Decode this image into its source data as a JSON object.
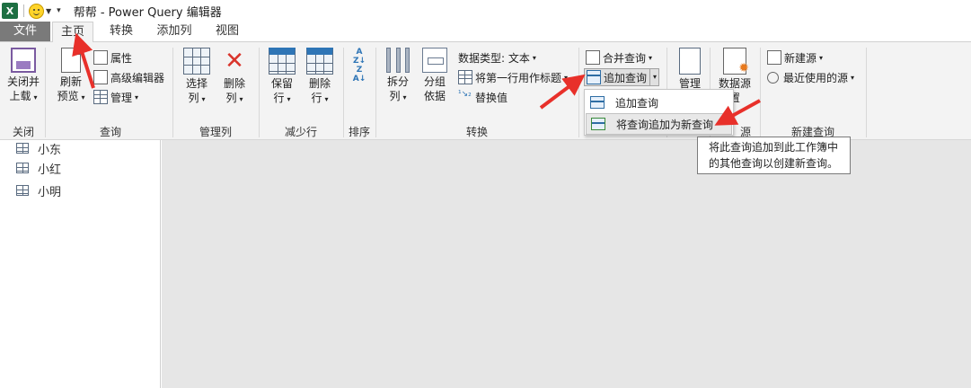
{
  "app": {
    "icon_letter": "X",
    "title": "帮帮 - Power Query 编辑器"
  },
  "tabs": [
    "文件",
    "主页",
    "转换",
    "添加列",
    "视图"
  ],
  "ribbon": {
    "close": {
      "btn": [
        "关闭并",
        "上载"
      ],
      "group": "关闭"
    },
    "query": {
      "refresh": [
        "刷新",
        "预览"
      ],
      "properties": "属性",
      "advanced_editor": "高级编辑器",
      "manage": "管理",
      "group": "查询"
    },
    "manage_columns": {
      "choose": [
        "选择",
        "列"
      ],
      "remove": [
        "删除",
        "列"
      ],
      "group": "管理列"
    },
    "reduce_rows": {
      "keep": [
        "保留",
        "行"
      ],
      "remove": [
        "删除",
        "行"
      ],
      "group": "减少行"
    },
    "sort": {
      "group": "排序"
    },
    "transform": {
      "split": [
        "拆分",
        "列"
      ],
      "group_by": [
        "分组",
        "依据"
      ],
      "data_type": "数据类型: 文本",
      "first_row_header": "将第一行用作标题",
      "replace_values": "替换值",
      "group": "转换"
    },
    "combine": {
      "merge_queries": "合并查询",
      "append_queries": "追加查询",
      "manage_params_partial": "管理",
      "data_source_partial": [
        "数据源",
        "置"
      ],
      "group_partial": "源"
    },
    "new_query": {
      "new_source": "新建源",
      "recent_sources": "最近使用的源",
      "group": "新建查询"
    }
  },
  "append_menu": {
    "items": [
      "追加查询",
      "将查询追加为新查询"
    ]
  },
  "tooltip": [
    "将此查询追加到此工作簿中",
    "的其他查询以创建新查询。"
  ],
  "queries": [
    "小东",
    "小红",
    "小明"
  ],
  "colors": {
    "excel_green": "#1d6f42",
    "file_tab": "#7a7a7a",
    "arrow_red": "#e8302a",
    "main_bg": "#e6e6e6"
  }
}
